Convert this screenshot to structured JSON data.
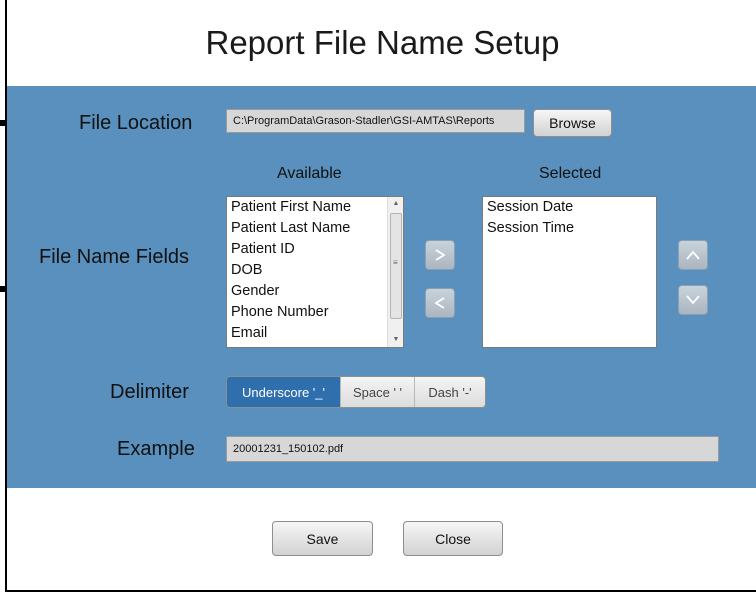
{
  "dialog": {
    "title": "Report File Name Setup"
  },
  "file_location": {
    "label": "File Location",
    "path": "C:\\ProgramData\\Grason-Stadler\\GSI-AMTAS\\Reports",
    "browse_label": "Browse"
  },
  "file_name_fields": {
    "label": "File Name Fields",
    "available_header": "Available",
    "selected_header": "Selected",
    "available": [
      "Patient First Name",
      "Patient Last Name",
      "Patient ID",
      "DOB",
      "Gender",
      "Phone Number",
      "Email"
    ],
    "selected": [
      "Session Date",
      "Session Time"
    ],
    "add_icon": "chevron-right-icon",
    "remove_icon": "chevron-left-icon",
    "move_up_icon": "chevron-up-icon",
    "move_down_icon": "chevron-down-icon"
  },
  "delimiter": {
    "label": "Delimiter",
    "options": [
      "Underscore '_'",
      "Space ' '",
      "Dash '-'"
    ],
    "selected": "Underscore '_'"
  },
  "example": {
    "label": "Example",
    "value": "20001231_150102.pdf"
  },
  "footer": {
    "save_label": "Save",
    "close_label": "Close"
  },
  "colors": {
    "panel_background": "#5990bd",
    "delimiter_active": "#2f6fae"
  }
}
